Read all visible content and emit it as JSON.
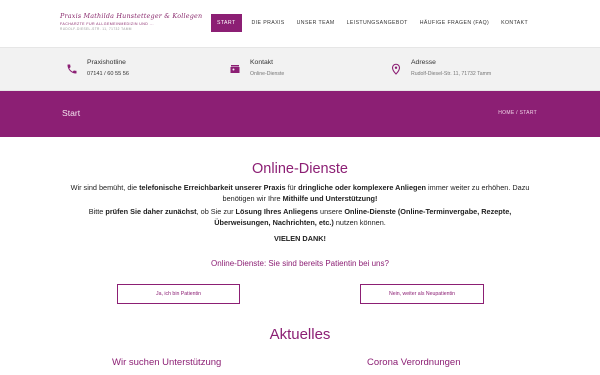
{
  "logo": {
    "name": "Praxis Mathilda Hunstetteger & Kollegen",
    "subtitle": "FACHARZTE FUR ALLGEMEINMEDIZIN UND ...",
    "address": "RUDOLF-DIESEL-STR. 11, 71732 TAMM"
  },
  "nav": {
    "items": [
      {
        "label": "Start",
        "active": true
      },
      {
        "label": "Die Praxis",
        "active": false
      },
      {
        "label": "Unser Team",
        "active": false
      },
      {
        "label": "Leistungsangebot",
        "active": false
      },
      {
        "label": "Häufige Fragen (FAQ)",
        "active": false
      },
      {
        "label": "Kontakt",
        "active": false
      }
    ]
  },
  "info": {
    "phone": {
      "title": "Praxishotline",
      "value": "07141 / 60 55 56",
      "icon": "phone-icon"
    },
    "contact": {
      "title": "Kontakt",
      "value": "Online-Dienste",
      "icon": "contact-card-icon"
    },
    "address": {
      "title": "Adresse",
      "value": "Rudolf-Diesel-Str. 11, 71732 Tamm",
      "icon": "map-pin-icon"
    }
  },
  "band": {
    "title": "Start",
    "breadcrumb": [
      "Home",
      "Start"
    ],
    "separator": "/"
  },
  "content": {
    "heading": "Online-Dienste",
    "p1": {
      "a": "Wir sind bemüht, die ",
      "b": "telefonische Erreichbarkeit unserer Praxis",
      "c": " für ",
      "d": "dringliche oder komplexere Anliegen",
      "e": " immer weiter zu erhöhen.  Dazu benötigen wir Ihre ",
      "f": "Mithilfe und Unterstützung!"
    },
    "p2": {
      "a": "Bitte ",
      "b": "prüfen Sie daher zunächst",
      "c": ", ob Sie zur ",
      "d": "Lösung Ihres Anliegens",
      "e": " unsere ",
      "f": "Online-Dienste (Online-Terminvergabe, Rezepte, Überweisungen, Nachrichten, etc.)",
      "g": " nutzen können."
    },
    "thanks": "VIELEN DANK!",
    "question": "Online-Dienste: Sie sind bereits Patientin bei uns?",
    "btn_yes": "Ja, ich bin Patientin",
    "btn_no": "Nein, weiter als Neupatientin",
    "news_heading": "Aktuelles",
    "news": [
      "Wir suchen Unterstützung",
      "Corona Verordnungen"
    ]
  },
  "colors": {
    "brand": "#8c1f74",
    "infobar": "#f2f2f2"
  }
}
